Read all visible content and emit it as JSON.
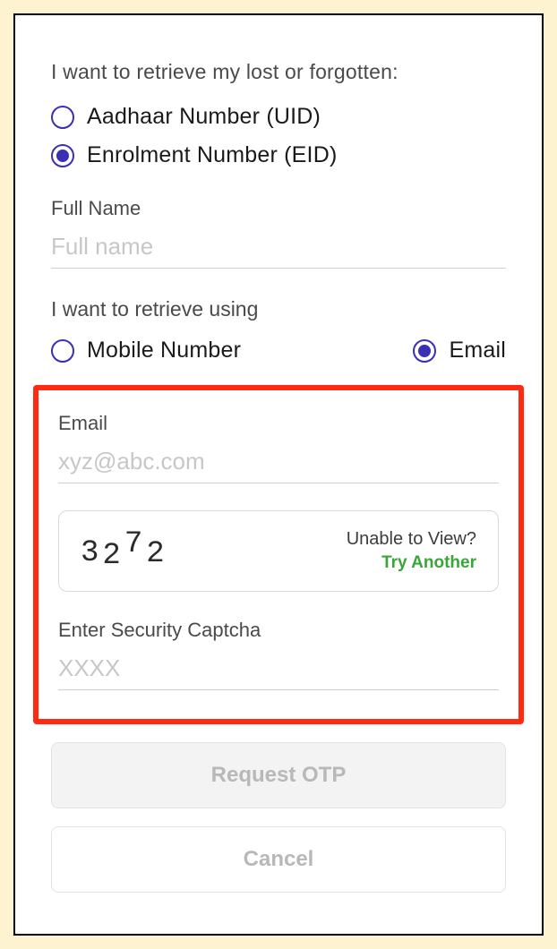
{
  "heading": "I want to retrieve my lost or forgotten:",
  "options": {
    "uid": "Aadhaar Number (UID)",
    "eid": "Enrolment Number (EID)"
  },
  "full_name": {
    "label": "Full Name",
    "placeholder": "Full name"
  },
  "retrieve_using": {
    "label": "I want to retrieve using",
    "mobile": "Mobile Number",
    "email": "Email"
  },
  "email_field": {
    "label": "Email",
    "placeholder": "xyz@abc.com"
  },
  "captcha": {
    "d1": "3",
    "d2": "2",
    "d3": "7",
    "d4": "2",
    "unable": "Unable to View?",
    "try_another": "Try Another"
  },
  "security_captcha": {
    "label": "Enter Security Captcha",
    "placeholder": "XXXX"
  },
  "buttons": {
    "request_otp": "Request OTP",
    "cancel": "Cancel"
  }
}
